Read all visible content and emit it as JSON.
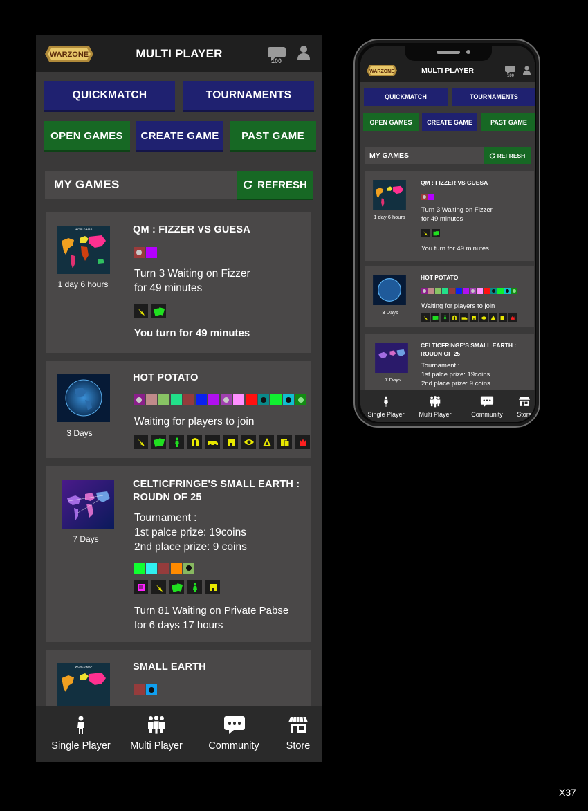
{
  "header": {
    "title": "MULTI PLAYER",
    "logo_text": "WARZONE",
    "chat_count": "100"
  },
  "actions": {
    "quickmatch": "QUICKMATCH",
    "tournaments": "TOURNAMENTS",
    "open_games": "OPEN GAMES",
    "create_game": "CREATE GAME",
    "past_game": "PAST GAME"
  },
  "my_games": {
    "title": "MY GAMES",
    "refresh": "REFRESH"
  },
  "games": [
    {
      "title": "QM : FIZZER VS GUESA",
      "time": "1 day 6 hours",
      "status_line1": "Turn 3 Waiting on Fizzer",
      "status_line2": "for 49 minutes",
      "footer": "You turn for 49 minutes",
      "players": [
        "#9a3b3b",
        "#b400ff"
      ]
    },
    {
      "title": "HOT POTATO",
      "time": "3 Days",
      "status_line1": "Waiting for players to join",
      "players": [
        "#8a1f8a",
        "#c08a8a",
        "#88c464",
        "#22e08a",
        "#933c3c",
        "#0a22f0",
        "#b010f0",
        "#a040b0",
        "#ff90ff",
        "#ff1010",
        "#0a8a8a",
        "#10f030",
        "#10c0d0",
        "#138a13"
      ]
    },
    {
      "title": "CELTICFRINGE'S SMALL EARTH : ROUDN OF 25",
      "time": "7 Days",
      "tour_line1": "Tournament :",
      "tour_line2": "1st palce prize: 19coins",
      "tour_line3": "2nd place prize: 9 coins",
      "status_line1": "Turn 81 Waiting on Private Pabse",
      "status_line2": "for 6 days 17 hours",
      "players": [
        "#10ff30",
        "#30f0f0",
        "#953c3c",
        "#ff8a00",
        "#88b860"
      ]
    },
    {
      "title": "SMALL EARTH",
      "players": [
        "#953c3c",
        "#10a0f0"
      ]
    }
  ],
  "nav": {
    "single": "Single Player",
    "multi": "Multi Player",
    "community": "Community",
    "store": "Store"
  },
  "watermark": "X37",
  "colors": {
    "blue_button": "#1f2170",
    "green_button": "#176824",
    "background": "#3a3939",
    "card": "#4a4848"
  },
  "icons": [
    "chat-icon",
    "user-icon",
    "refresh-icon",
    "person-icon",
    "group-icon",
    "speech-bubble-icon",
    "store-icon"
  ]
}
